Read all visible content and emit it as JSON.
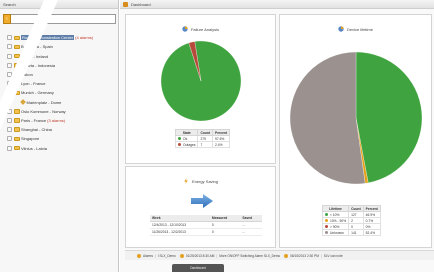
{
  "left_panel": {
    "title": "Search",
    "search_value": "",
    "search_toggle_glyph": "‹",
    "tree": [
      {
        "label": "Root - Demonstration Center",
        "alarm": "(4 alarms)",
        "selected": true,
        "kind": "folder",
        "indent": 0
      },
      {
        "label": "Barcelona - Spain",
        "alarm": "",
        "selected": false,
        "kind": "folder",
        "indent": 1
      },
      {
        "label": "Dublin - Ireland",
        "alarm": "",
        "selected": false,
        "kind": "folder",
        "indent": 1
      },
      {
        "label": "Jakarta - Indonesia",
        "alarm": "",
        "selected": false,
        "kind": "folder",
        "indent": 1
      },
      {
        "label": "Lisbon",
        "alarm": "",
        "selected": false,
        "kind": "folder",
        "indent": 1
      },
      {
        "label": "Lyon - France",
        "alarm": "",
        "selected": false,
        "kind": "folder",
        "indent": 1
      },
      {
        "label": "Munich - Germany",
        "alarm": "",
        "selected": false,
        "kind": "folder",
        "indent": 1
      },
      {
        "label": "Marienplatz - Dome",
        "alarm": "",
        "selected": false,
        "kind": "leaf",
        "indent": 2
      },
      {
        "label": "Oslo Kommune - Norway",
        "alarm": "",
        "selected": false,
        "kind": "folder",
        "indent": 1
      },
      {
        "label": "Paris - France",
        "alarm": "(3 alarms)",
        "selected": false,
        "kind": "folder",
        "indent": 1
      },
      {
        "label": "Shanghai - China",
        "alarm": "",
        "selected": false,
        "kind": "folder",
        "indent": 1
      },
      {
        "label": "Singapore",
        "alarm": "",
        "selected": false,
        "kind": "folder",
        "indent": 1
      },
      {
        "label": "Vilnius - Latvia",
        "alarm": "",
        "selected": false,
        "kind": "folder",
        "indent": 1
      }
    ]
  },
  "right_panel": {
    "title": "Dashboard"
  },
  "failure_analysis": {
    "title": "Failure Analysis",
    "headers": [
      "State",
      "Count",
      "Percent"
    ],
    "rows": [
      {
        "color": "#3fa33f",
        "state": "Ok",
        "count": "279",
        "percent": "97.6%"
      },
      {
        "color": "#b84a3c",
        "state": "Outages",
        "count": "7",
        "percent": "2.4%"
      }
    ]
  },
  "energy_saving": {
    "title": "Energy Saving",
    "headers": [
      "Week",
      "Measured",
      "Saved"
    ],
    "rows": [
      {
        "week": "12/4/2013 - 12/10/2013",
        "measured": "0",
        "saved": "..."
      },
      {
        "week": "11/26/2013 - 12/2/2013",
        "measured": "0",
        "saved": "..."
      }
    ]
  },
  "device_lifetime": {
    "title": "Device lifetime",
    "headers": [
      "Lifetime",
      "Count",
      "Percent"
    ],
    "rows": [
      {
        "color": "#3fa33f",
        "label": "< 10%",
        "count": "127",
        "percent": "46.9%"
      },
      {
        "color": "#e3a21a",
        "label": "10% - 90%",
        "count": "2",
        "percent": "0.7%"
      },
      {
        "color": "#b84a3c",
        "label": "> 90%",
        "count": "0",
        "percent": "0%"
      },
      {
        "color": "#9b9290",
        "label": "Unknown",
        "count": "141",
        "percent": "52.4%"
      }
    ]
  },
  "chart_data": [
    {
      "type": "pie",
      "title": "Failure Analysis",
      "categories": [
        "Ok",
        "Outages"
      ],
      "values": [
        279,
        7
      ],
      "colors": [
        "#3fa33f",
        "#b84a3c"
      ]
    },
    {
      "type": "pie",
      "title": "Device lifetime",
      "categories": [
        "< 10%",
        "10% - 90%",
        "> 90%",
        "Unknown"
      ],
      "values": [
        127,
        2,
        0,
        141
      ],
      "colors": [
        "#3fa33f",
        "#e3a21a",
        "#b84a3c",
        "#9b9290"
      ]
    }
  ],
  "statusbar": {
    "items": [
      "Alarms",
      "I SLX_Demo",
      "01/25/2013 8:30 AM",
      "More ON/OFF Switching Alarm SLX_Demo",
      "08/15/2013 2:30 PM",
      "SLV can note"
    ]
  },
  "bottom_tab": {
    "label": "Dashboard"
  },
  "colors": {
    "accent": "#f0ad2d",
    "selection": "#5e7ea8",
    "pie_green": "#3fa33f",
    "pie_grey": "#9b9290"
  }
}
